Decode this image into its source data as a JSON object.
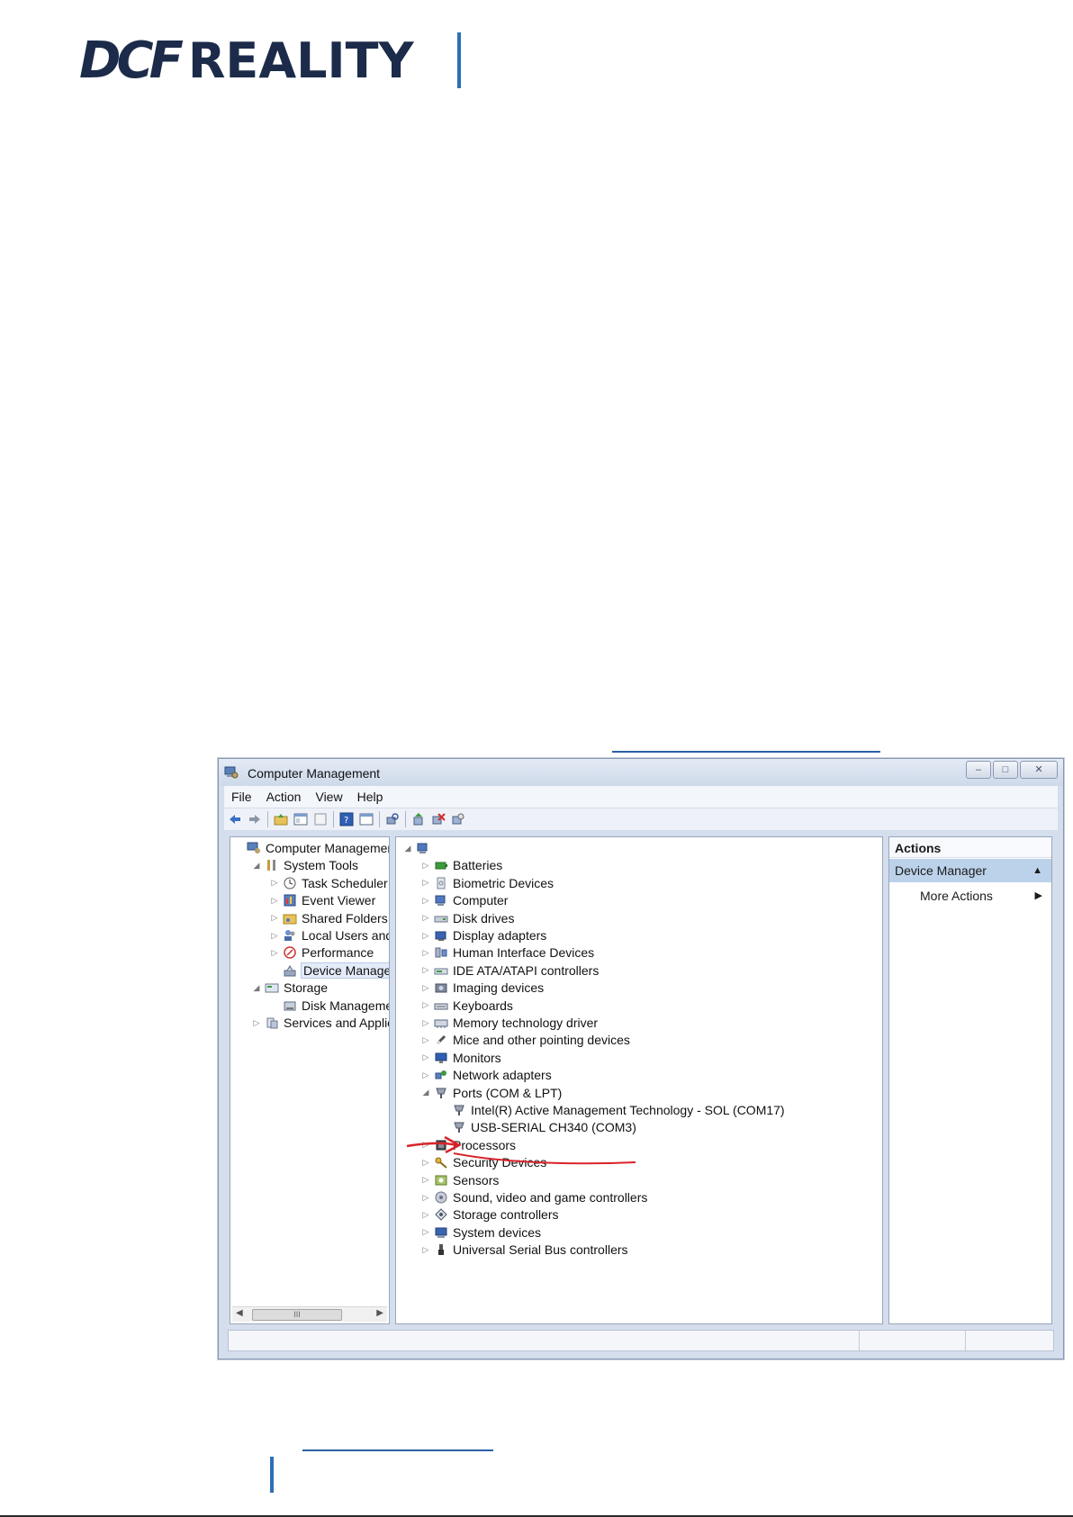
{
  "header": {
    "logo_left": "DCF",
    "logo_right": "REALITY"
  },
  "window": {
    "title": "Computer Management",
    "controls": [
      "–",
      "□",
      "✕"
    ],
    "menu": [
      "File",
      "Action",
      "View",
      "Help"
    ]
  },
  "left_tree": [
    {
      "label": "Computer Management",
      "level": 0,
      "expander": "",
      "icon": "computer-management-icon"
    },
    {
      "label": "System Tools",
      "level": 1,
      "expander": "◢",
      "icon": "tools-icon"
    },
    {
      "label": "Task Scheduler",
      "level": 2,
      "expander": "▷",
      "icon": "clock-icon"
    },
    {
      "label": "Event Viewer",
      "level": 2,
      "expander": "▷",
      "icon": "event-viewer-icon"
    },
    {
      "label": "Shared Folders",
      "level": 2,
      "expander": "▷",
      "icon": "shared-folder-icon"
    },
    {
      "label": "Local Users and G",
      "level": 2,
      "expander": "▷",
      "icon": "users-icon"
    },
    {
      "label": "Performance",
      "level": 2,
      "expander": "▷",
      "icon": "performance-icon"
    },
    {
      "label": "Device Manager",
      "level": 2,
      "expander": "",
      "icon": "device-manager-icon",
      "selected": true
    },
    {
      "label": "Storage",
      "level": 1,
      "expander": "◢",
      "icon": "storage-icon"
    },
    {
      "label": "Disk Management",
      "level": 2,
      "expander": "",
      "icon": "disk-management-icon"
    },
    {
      "label": "Services and Applicat",
      "level": 1,
      "expander": "▷",
      "icon": "services-icon"
    }
  ],
  "device_tree": [
    {
      "label": "",
      "level": 0,
      "expander": "◢",
      "icon": "computer-icon"
    },
    {
      "label": "Batteries",
      "level": 1,
      "expander": "▷",
      "icon": "battery-icon"
    },
    {
      "label": "Biometric Devices",
      "level": 1,
      "expander": "▷",
      "icon": "biometric-icon"
    },
    {
      "label": "Computer",
      "level": 1,
      "expander": "▷",
      "icon": "computer-icon"
    },
    {
      "label": "Disk drives",
      "level": 1,
      "expander": "▷",
      "icon": "disk-drive-icon"
    },
    {
      "label": "Display adapters",
      "level": 1,
      "expander": "▷",
      "icon": "display-adapter-icon"
    },
    {
      "label": "Human Interface Devices",
      "level": 1,
      "expander": "▷",
      "icon": "hid-icon"
    },
    {
      "label": "IDE ATA/ATAPI controllers",
      "level": 1,
      "expander": "▷",
      "icon": "ide-controller-icon"
    },
    {
      "label": "Imaging devices",
      "level": 1,
      "expander": "▷",
      "icon": "imaging-icon"
    },
    {
      "label": "Keyboards",
      "level": 1,
      "expander": "▷",
      "icon": "keyboard-icon"
    },
    {
      "label": "Memory technology driver",
      "level": 1,
      "expander": "▷",
      "icon": "memory-icon"
    },
    {
      "label": "Mice and other pointing devices",
      "level": 1,
      "expander": "▷",
      "icon": "mouse-icon"
    },
    {
      "label": "Monitors",
      "level": 1,
      "expander": "▷",
      "icon": "monitor-icon"
    },
    {
      "label": "Network adapters",
      "level": 1,
      "expander": "▷",
      "icon": "network-icon"
    },
    {
      "label": "Ports (COM & LPT)",
      "level": 1,
      "expander": "◢",
      "icon": "port-icon"
    },
    {
      "label": "Intel(R) Active Management Technology - SOL (COM17)",
      "level": 2,
      "expander": "",
      "icon": "port-icon"
    },
    {
      "label": "USB-SERIAL CH340 (COM3)",
      "level": 2,
      "expander": "",
      "icon": "port-icon",
      "annotated": true
    },
    {
      "label": "Processors",
      "level": 1,
      "expander": "▷",
      "icon": "processor-icon"
    },
    {
      "label": "Security Devices",
      "level": 1,
      "expander": "▷",
      "icon": "security-icon"
    },
    {
      "label": "Sensors",
      "level": 1,
      "expander": "▷",
      "icon": "sensor-icon"
    },
    {
      "label": "Sound, video and game controllers",
      "level": 1,
      "expander": "▷",
      "icon": "sound-icon"
    },
    {
      "label": "Storage controllers",
      "level": 1,
      "expander": "▷",
      "icon": "storage-controller-icon"
    },
    {
      "label": "System devices",
      "level": 1,
      "expander": "▷",
      "icon": "system-device-icon"
    },
    {
      "label": "Universal Serial Bus controllers",
      "level": 1,
      "expander": "▷",
      "icon": "usb-icon"
    }
  ],
  "actions": {
    "heading": "Actions",
    "section": "Device Manager",
    "section_caret": "▲",
    "more": "More Actions",
    "more_caret": "▶"
  },
  "scroll_thumb": "III",
  "colors": {
    "annotation": "#d9232a",
    "logo": "#1c2b4a",
    "accent_bar": "#2c6fb6"
  }
}
